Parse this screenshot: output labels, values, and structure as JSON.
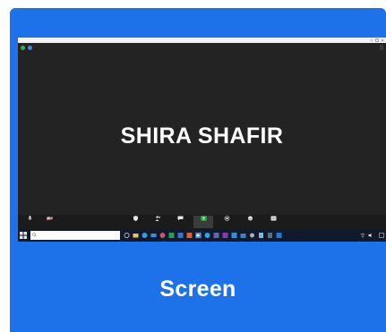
{
  "card": {
    "label": "Screen",
    "accent": "#1e72e9"
  },
  "screenshot": {
    "window_title": "",
    "view_button": "",
    "participant_name": "SHIRA SHAFIR",
    "meeting_controls": {
      "left": [
        {
          "name": "unmute",
          "icon": "microphone-icon",
          "label": ""
        },
        {
          "name": "start-video",
          "icon": "video-camera-icon",
          "label": ""
        }
      ],
      "center": [
        {
          "name": "security",
          "icon": "shield-icon",
          "label": ""
        },
        {
          "name": "participants",
          "icon": "people-icon",
          "label": ""
        },
        {
          "name": "chat",
          "icon": "chat-icon",
          "label": ""
        },
        {
          "name": "share-screen",
          "icon": "share-screen-icon",
          "label": "",
          "active": true
        },
        {
          "name": "record",
          "icon": "record-icon",
          "label": ""
        },
        {
          "name": "reactions",
          "icon": "smile-icon",
          "label": ""
        },
        {
          "name": "more",
          "icon": "more-icon",
          "label": ""
        }
      ],
      "end_label": ""
    },
    "taskbar": {
      "search_placeholder": "",
      "clock_time": "",
      "clock_date": ""
    }
  }
}
